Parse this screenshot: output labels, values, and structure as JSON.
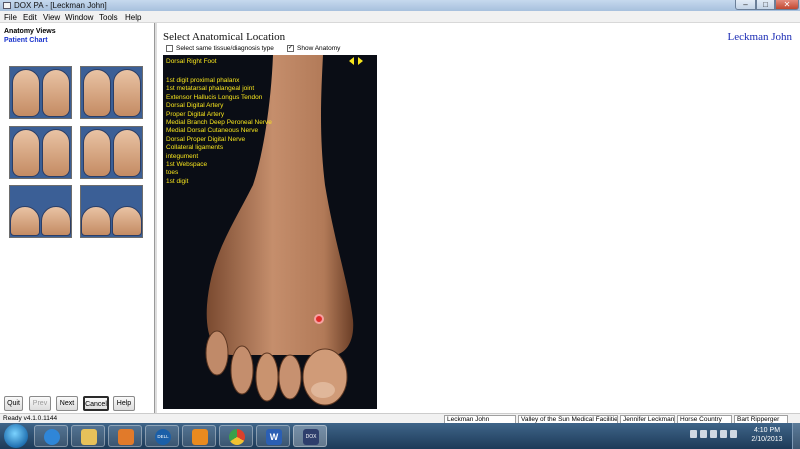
{
  "window": {
    "title": "DOX PA - [Leckman John]",
    "min_glyph": "–",
    "max_glyph": "□",
    "close_glyph": "✕"
  },
  "menu": [
    "File",
    "Edit",
    "View",
    "Window",
    "Tools",
    "Help"
  ],
  "sidebar": {
    "anatomy_views": "Anatomy Views",
    "patient_chart": "Patient Chart"
  },
  "buttons": {
    "quit": "Quit",
    "prev": "Prev",
    "next": "Next",
    "cancel": "Cancel",
    "help": "Help"
  },
  "main": {
    "title": "Select Anatomical Location",
    "patient_name": "Leckman  John",
    "same_tissue_label": "Select same tissue/diagnosis type",
    "same_tissue_checked": false,
    "show_anatomy_label": "Show Anatomy",
    "show_anatomy_checked": true,
    "check_glyph": "✓"
  },
  "anatomy": {
    "region": "Dorsal Right Foot",
    "structures": [
      "1st digit proximal phalanx",
      "1st metatarsal phalangeal joint",
      "Extensor Hallucis Longus Tendon",
      "Dorsal Digital Artery",
      "Proper Digital Artery",
      "Medial Branch Deep Peroneal Nerve",
      "Medial Dorsal Cutaneous Nerve",
      "Dorsal Proper Digital Nerve",
      "Collateral ligaments",
      "integument",
      "1st Webspace",
      "toes",
      "1st digit"
    ]
  },
  "statusbar": {
    "version": "Ready v4.1.0.1144",
    "patient": "Leckman  John",
    "facility": "Valley of the Sun Medical Facilities",
    "provider": "Jennifer  Leckman",
    "location": "Horse Country",
    "user": "Bart  Ripperger"
  },
  "taskbar": {
    "time": "4:10 PM",
    "date": "2/10/2013",
    "apps": [
      "internet-explorer",
      "file-explorer",
      "media-player",
      "dell",
      "outlook",
      "chrome",
      "word",
      "dox"
    ],
    "app_labels": {
      "dell": "DELL",
      "word": "W",
      "dox": "DOX"
    }
  }
}
